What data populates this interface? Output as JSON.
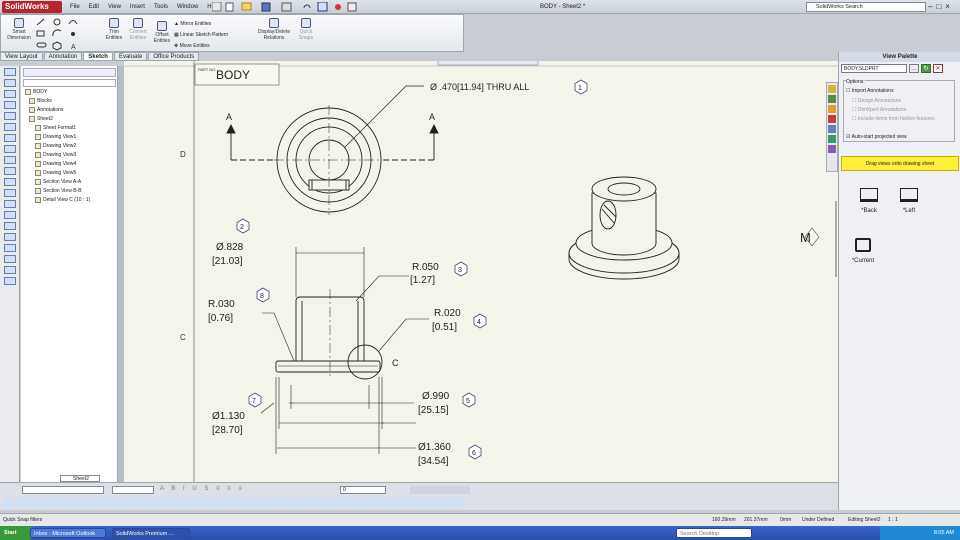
{
  "app": {
    "name": "SolidWorks",
    "doc_title": "BODY - Sheet2 *",
    "search_placeholder": "SolidWorks Search",
    "menu": [
      "File",
      "Edit",
      "View",
      "Insert",
      "Tools",
      "Window",
      "Help"
    ]
  },
  "ribbon": {
    "smart_dimension": "Smart Dimension",
    "trim": "Trim Entities",
    "convert": "Convert Entities",
    "offset": "Offset Entities",
    "mirror": "Mirror Entities",
    "linear_pattern": "Linear Sketch Pattern",
    "move": "Move Entities",
    "display_delete": "Display/Delete Relations",
    "quick_snaps": "Quick Snaps"
  },
  "tabs": [
    "View Layout",
    "Annotation",
    "Sketch",
    "Evaluate",
    "Office Products"
  ],
  "tree": {
    "root": "BODY",
    "items": [
      "Blocks",
      "Annotations",
      "Sheet2",
      "Sheet Format1",
      "Drawing View1",
      "Drawing View2",
      "Drawing View3",
      "Drawing View4",
      "Drawing View5",
      "Section View A-A",
      "Section View B-B",
      "Detail View C (10 : 1)"
    ]
  },
  "drawing": {
    "part_no_label": "PART NO.",
    "part_name": "BODY",
    "row_d": "D",
    "row_c": "C",
    "section_a": "A",
    "detail_c": "C",
    "m_label": "M",
    "callouts": [
      {
        "num": "1",
        "text": "Ø .470[11.94]  THRU ALL"
      },
      {
        "num": "2",
        "line1": "Ø.828",
        "line2": "[21.03]"
      },
      {
        "num": "3",
        "line1": "R.050",
        "line2": "[1.27]"
      },
      {
        "num": "4",
        "line1": "R.020",
        "line2": "[0.51]"
      },
      {
        "num": "5",
        "line1": "Ø.990",
        "line2": "[25.15]"
      },
      {
        "num": "6",
        "line1": "Ø1.360",
        "line2": "[34.54]"
      },
      {
        "num": "7",
        "line1": "Ø1.130",
        "line2": "[28.70]"
      },
      {
        "num": "8",
        "line1": "R.030",
        "line2": "[0.76]"
      }
    ]
  },
  "sheet_tab": "Sheet2",
  "palette": {
    "title": "View Palette",
    "file": "BODY.SLDPRT",
    "options_label": "Options:",
    "import_annotations": "Import Annotations",
    "design_annotations": "Design Annotations",
    "dimxpert_annotations": "DimXpert Annotations",
    "include_hidden": "Include items from hidden features",
    "auto_start": "Auto-start projected view",
    "drag_hint": "Drag views onto drawing sheet",
    "views": [
      "*Back",
      "*Left",
      "*Current"
    ]
  },
  "status": {
    "hint": "Quick Snap filters",
    "x": "160.39mm",
    "y": "201.37mm",
    "z": "0mm",
    "state": "Under Defined",
    "editing": "Editing Sheet2",
    "scale": "1 : 1"
  },
  "bottom_toolbar": {
    "layer": "0"
  },
  "taskbar": {
    "start": "Start",
    "items": [
      "Inbox - Microsoft Outlook",
      "SolidWorks Premium ..."
    ],
    "search": "Search Desktop",
    "time": "8:05 AM"
  }
}
